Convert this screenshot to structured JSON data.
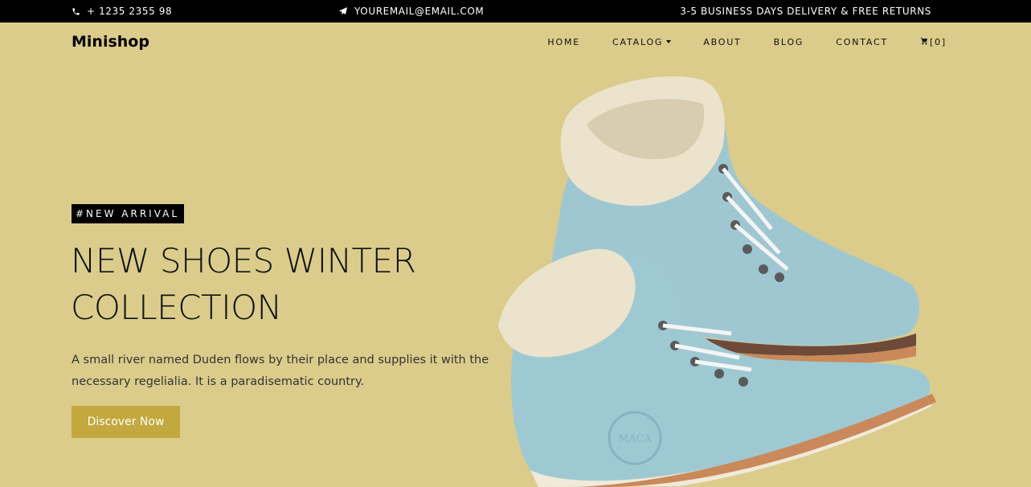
{
  "topbar": {
    "phone": "+ 1235 2355 98",
    "email": "YOUREMAIL@EMAIL.COM",
    "delivery": "3-5 BUSINESS DAYS DELIVERY & FREE RETURNS",
    "phone_icon": "phone-icon",
    "email_icon": "paper-plane-icon"
  },
  "navbar": {
    "brand": "Minishop",
    "links": [
      {
        "label": "HOME"
      },
      {
        "label": "CATALOG"
      },
      {
        "label": "ABOUT"
      },
      {
        "label": "BLOG"
      },
      {
        "label": "CONTACT"
      }
    ],
    "cart_count": "[0]",
    "cart_icon": "cart-icon"
  },
  "hero": {
    "badge": "#NEW ARRIVAL",
    "title": "NEW SHOES WINTER COLLECTION",
    "text": "A small river named Duden flows by their place and supplies it with the necessary regelialia. It is a paradisematic country.",
    "button": "Discover Now",
    "image_label": "MACA"
  },
  "colors": {
    "background": "#dbcc8b",
    "topbar": "#000000",
    "button": "#c2a83e",
    "boot": "#9ec9d3",
    "sole": "#c9895a",
    "fur": "#ece3cc"
  }
}
